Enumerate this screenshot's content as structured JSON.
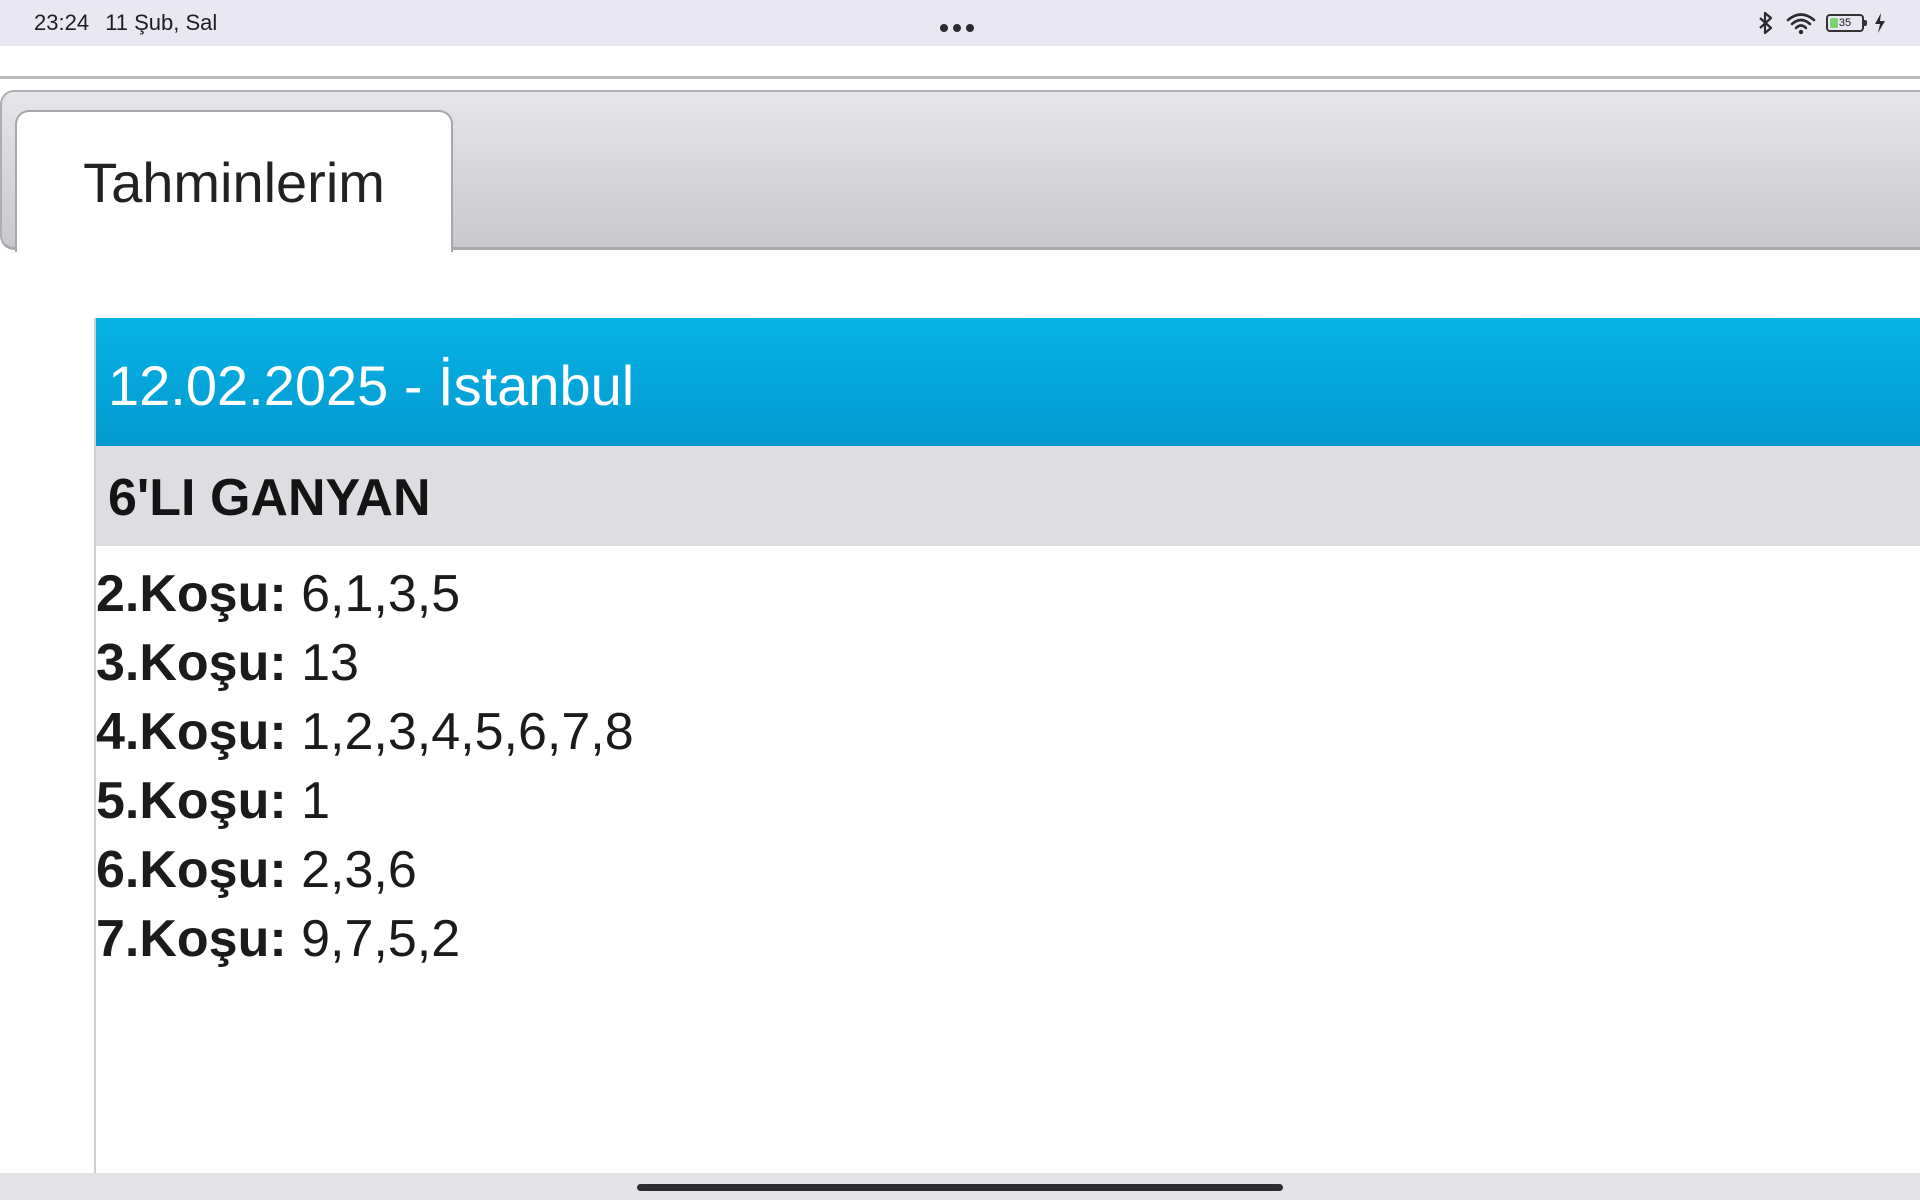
{
  "status_bar": {
    "time": "23:24",
    "date": "11 Şub, Sal",
    "battery_level": "35",
    "battery_fraction": 0.35,
    "icons": [
      "more-dots-icon",
      "bluetooth-icon",
      "wifi-icon",
      "battery-icon",
      "charging-icon"
    ]
  },
  "tabs": [
    {
      "label": "Tahminlerim",
      "active": true
    }
  ],
  "prediction": {
    "header": "12.02.2025 - İstanbul",
    "bet_type": "6'LI GANYAN",
    "races": [
      {
        "label": "2.Koşu:",
        "value": "6,1,3,5"
      },
      {
        "label": "3.Koşu:",
        "value": "13"
      },
      {
        "label": "4.Koşu:",
        "value": "1,2,3,4,5,6,7,8"
      },
      {
        "label": "5.Koşu:",
        "value": "1"
      },
      {
        "label": "6.Koşu:",
        "value": "2,3,6"
      },
      {
        "label": "7.Koşu:",
        "value": "9,7,5,2"
      }
    ]
  },
  "colors": {
    "header_bg": "#03a9df",
    "bet_type_bg": "#dedde2",
    "status_bar_bg": "#e9e8f2"
  }
}
